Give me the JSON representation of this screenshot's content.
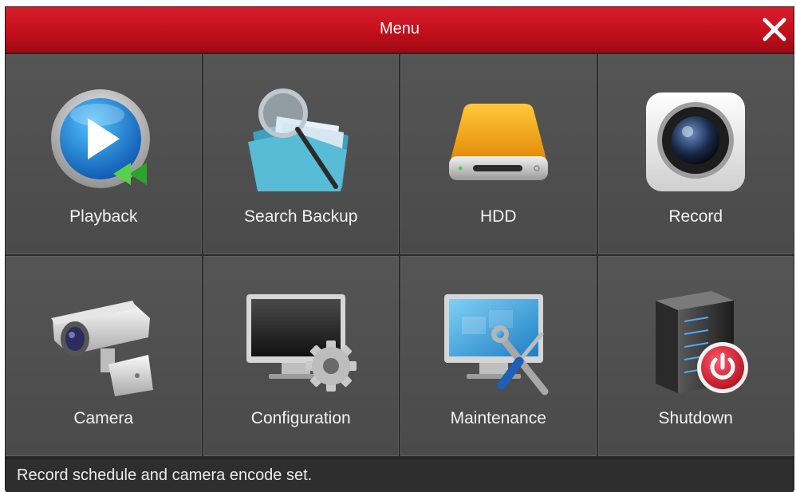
{
  "window": {
    "title": "Menu",
    "close_icon": "close-icon"
  },
  "tiles": [
    {
      "label": "Playback",
      "icon": "playback-icon"
    },
    {
      "label": "Search Backup",
      "icon": "search-backup-icon"
    },
    {
      "label": "HDD",
      "icon": "hdd-icon"
    },
    {
      "label": "Record",
      "icon": "record-icon"
    },
    {
      "label": "Camera",
      "icon": "camera-icon"
    },
    {
      "label": "Configuration",
      "icon": "configuration-icon"
    },
    {
      "label": "Maintenance",
      "icon": "maintenance-icon"
    },
    {
      "label": "Shutdown",
      "icon": "shutdown-icon"
    }
  ],
  "status": {
    "text": "Record schedule and camera encode set."
  },
  "colors": {
    "titlebar": "#c8141f",
    "tile": "#505050",
    "text": "#f2f2f2"
  }
}
